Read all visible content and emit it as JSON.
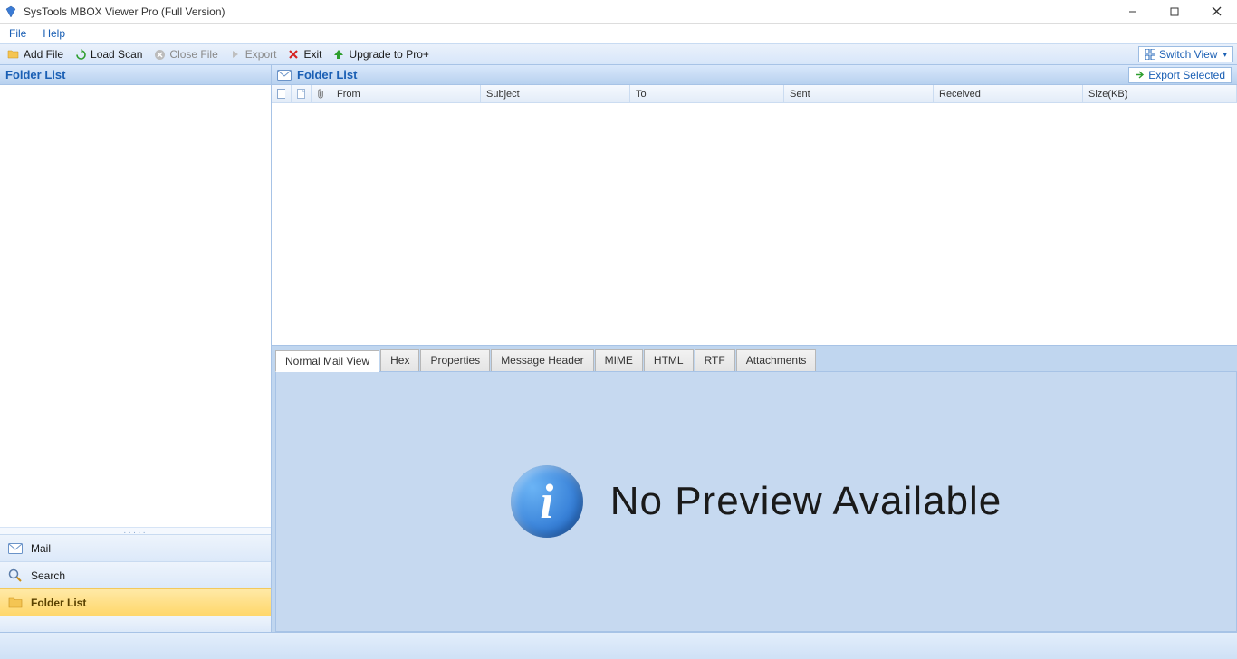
{
  "window": {
    "title": "SysTools MBOX Viewer Pro (Full Version)"
  },
  "menu": {
    "file": "File",
    "help": "Help"
  },
  "toolbar": {
    "add_file": "Add File",
    "load_scan": "Load Scan",
    "close_file": "Close File",
    "export": "Export",
    "exit": "Exit",
    "upgrade": "Upgrade to Pro+",
    "switch_view": "Switch View"
  },
  "left": {
    "header": "Folder List",
    "nav": {
      "mail": "Mail",
      "search": "Search",
      "folder_list": "Folder List"
    }
  },
  "right": {
    "header": "Folder List",
    "export_selected": "Export Selected",
    "columns": {
      "from": "From",
      "subject": "Subject",
      "to": "To",
      "sent": "Sent",
      "received": "Received",
      "size": "Size(KB)"
    }
  },
  "tabs": {
    "normal": "Normal Mail View",
    "hex": "Hex",
    "properties": "Properties",
    "message_header": "Message Header",
    "mime": "MIME",
    "html": "HTML",
    "rtf": "RTF",
    "attachments": "Attachments"
  },
  "preview": {
    "no_preview": "No Preview Available"
  }
}
